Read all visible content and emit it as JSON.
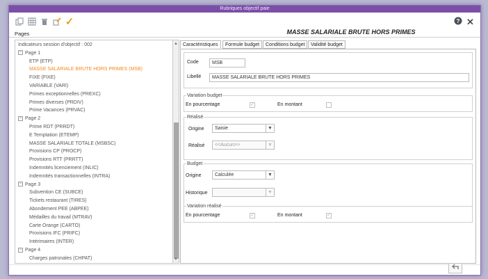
{
  "window": {
    "title": "Rubriques objectif paie"
  },
  "toolbar": {
    "help_glyph": "?",
    "close_glyph": "✕"
  },
  "pages_label": "Pages",
  "header_title": "MASSE SALARIALE BRUTE HORS PRIMES",
  "tree": [
    {
      "label": "Indicateurs session d'objectif : 002",
      "level": 0,
      "toggle": ""
    },
    {
      "label": "Page 1",
      "level": 1,
      "toggle": "−"
    },
    {
      "label": "ETP (ETP)",
      "level": 2,
      "toggle": ""
    },
    {
      "label": "MASSE SALARIALE BRUTE HORS PRIMES  (MSB)",
      "level": 2,
      "toggle": "",
      "selected": true
    },
    {
      "label": "FIXE (FIXE)",
      "level": 2,
      "toggle": ""
    },
    {
      "label": "VARIABLE (VARI)",
      "level": 2,
      "toggle": ""
    },
    {
      "label": "Primes exceptionnelles (PREXC)",
      "level": 2,
      "toggle": ""
    },
    {
      "label": "Primes diverses (PRDIV)",
      "level": 2,
      "toggle": ""
    },
    {
      "label": "Prime Vacances  (PRVAC)",
      "level": 2,
      "toggle": ""
    },
    {
      "label": "Page 2",
      "level": 1,
      "toggle": "−"
    },
    {
      "label": "Prime RDT (PRRDT)",
      "level": 2,
      "toggle": ""
    },
    {
      "label": "E Temptation (ETEMP)",
      "level": 2,
      "toggle": ""
    },
    {
      "label": "MASSE SALARIALE TOTALE  (MSBSC)",
      "level": 2,
      "toggle": ""
    },
    {
      "label": "Provisions CP (PROCP)",
      "level": 2,
      "toggle": ""
    },
    {
      "label": "Provisions RTT (PRRTT)",
      "level": 2,
      "toggle": ""
    },
    {
      "label": "Indemnités licenciement (INLIC)",
      "level": 2,
      "toggle": ""
    },
    {
      "label": "Indemnités transactionnelles (INTRA)",
      "level": 2,
      "toggle": ""
    },
    {
      "label": "Page 3",
      "level": 1,
      "toggle": "−"
    },
    {
      "label": "Subvention CE  (SUBCE)",
      "level": 2,
      "toggle": ""
    },
    {
      "label": "Tickets restaurant  (TIRES)",
      "level": 2,
      "toggle": ""
    },
    {
      "label": "Abondement PEE (ABPEE)",
      "level": 2,
      "toggle": ""
    },
    {
      "label": "Médailles du travail  (MTRAV)",
      "level": 2,
      "toggle": ""
    },
    {
      "label": "Carte Orange (CARTO)",
      "level": 2,
      "toggle": ""
    },
    {
      "label": "Provisions IFC (PRIFC)",
      "level": 2,
      "toggle": ""
    },
    {
      "label": "Intérimaires (INTER)",
      "level": 2,
      "toggle": ""
    },
    {
      "label": "Page 4",
      "level": 1,
      "toggle": "−"
    },
    {
      "label": "Charges patronales  (CHPAT)",
      "level": 2,
      "toggle": ""
    }
  ],
  "tabs": [
    "Caractéristiques",
    "Formule budget",
    "Conditions budget",
    "Validité budget"
  ],
  "form": {
    "code_label": "Code",
    "code_value": "MSB",
    "libelle_label": "Libellé",
    "libelle_value": "MASSE SALARIALE BRUTE HORS PRIMES",
    "variation_budget": {
      "title": "Variation budget",
      "pct_label": "En pourcentage",
      "pct_checked": true,
      "montant_label": "En montant",
      "montant_checked": false
    },
    "realise": {
      "title": "Réalisé",
      "origine_label": "Origine",
      "origine_value": "Saisie",
      "realise_label": "Réalisé",
      "realise_value": "<<Aucun>>"
    },
    "budget": {
      "title": "Budget",
      "origine_label": "Origine",
      "origine_value": "Calculée",
      "historique_label": "Historique",
      "historique_value": ""
    },
    "variation_realise": {
      "title": "Variation réalisé",
      "pct_label": "En pourcentage",
      "pct_checked": true,
      "montant_label": "En montant",
      "montant_checked": true
    }
  },
  "icons": [
    "copy-icon",
    "grid-icon",
    "trash-icon",
    "edit-icon",
    "check-icon",
    "help-icon",
    "close-icon",
    "back-arrow-icon"
  ],
  "colors": {
    "titlebar": "#7b4fa8",
    "selected_item": "#f08a1c",
    "check_accent": "#f0a020"
  }
}
